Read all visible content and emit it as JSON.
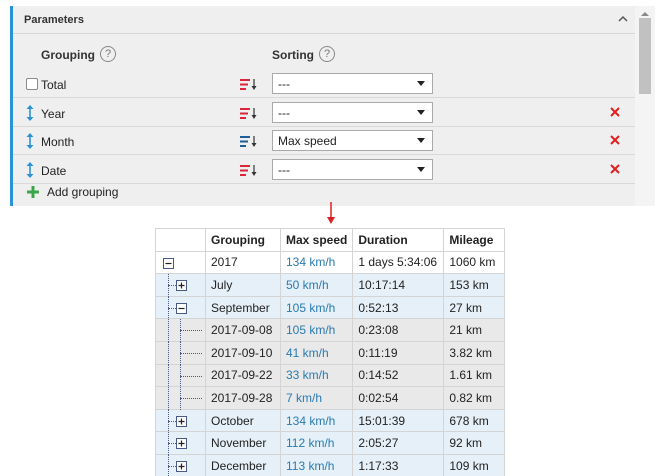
{
  "panel": {
    "title": "Parameters",
    "grouping_label": "Grouping",
    "sorting_label": "Sorting",
    "help_glyph": "?",
    "rows": [
      {
        "label": "Total",
        "control": "checkbox",
        "sort": "---",
        "deletable": false
      },
      {
        "label": "Year",
        "control": "drag",
        "sort": "---",
        "deletable": true
      },
      {
        "label": "Month",
        "control": "drag",
        "sort": "Max speed",
        "deletable": true
      },
      {
        "label": "Date",
        "control": "drag",
        "sort": "---",
        "deletable": true
      }
    ],
    "add_label": "Add grouping"
  },
  "colors": {
    "accent": "#2a93d5",
    "delete": "#e02020",
    "add": "#3aa64a",
    "sort_icon_red": "#d9263a",
    "sort_icon_blue": "#1f5d99",
    "speed_link": "#2a7ab0"
  },
  "table": {
    "headers": [
      "Grouping",
      "Max speed",
      "Duration",
      "Mileage"
    ],
    "rows": [
      {
        "level": 0,
        "toggle": "minus",
        "grouping": "2017",
        "max_speed": "134 km/h",
        "duration": "1 days 5:34:06",
        "mileage": "1060 km"
      },
      {
        "level": 1,
        "toggle": "plus",
        "grouping": "July",
        "max_speed": "50 km/h",
        "duration": "10:17:14",
        "mileage": "153 km"
      },
      {
        "level": 1,
        "toggle": "minus",
        "grouping": "September",
        "max_speed": "105 km/h",
        "duration": "0:52:13",
        "mileage": "27 km"
      },
      {
        "level": 2,
        "toggle": "none",
        "grouping": "2017-09-08",
        "max_speed": "105 km/h",
        "duration": "0:23:08",
        "mileage": "21 km"
      },
      {
        "level": 2,
        "toggle": "none",
        "grouping": "2017-09-10",
        "max_speed": "41 km/h",
        "duration": "0:11:19",
        "mileage": "3.82 km"
      },
      {
        "level": 2,
        "toggle": "none",
        "grouping": "2017-09-22",
        "max_speed": "33 km/h",
        "duration": "0:14:52",
        "mileage": "1.61 km"
      },
      {
        "level": 2,
        "toggle": "none",
        "grouping": "2017-09-28",
        "max_speed": "7 km/h",
        "duration": "0:02:54",
        "mileage": "0.82 km"
      },
      {
        "level": 1,
        "toggle": "plus",
        "grouping": "October",
        "max_speed": "134 km/h",
        "duration": "15:01:39",
        "mileage": "678 km"
      },
      {
        "level": 1,
        "toggle": "plus",
        "grouping": "November",
        "max_speed": "112 km/h",
        "duration": "2:05:27",
        "mileage": "92 km"
      },
      {
        "level": 1,
        "toggle": "plus",
        "grouping": "December",
        "max_speed": "113 km/h",
        "duration": "1:17:33",
        "mileage": "109 km"
      }
    ]
  }
}
